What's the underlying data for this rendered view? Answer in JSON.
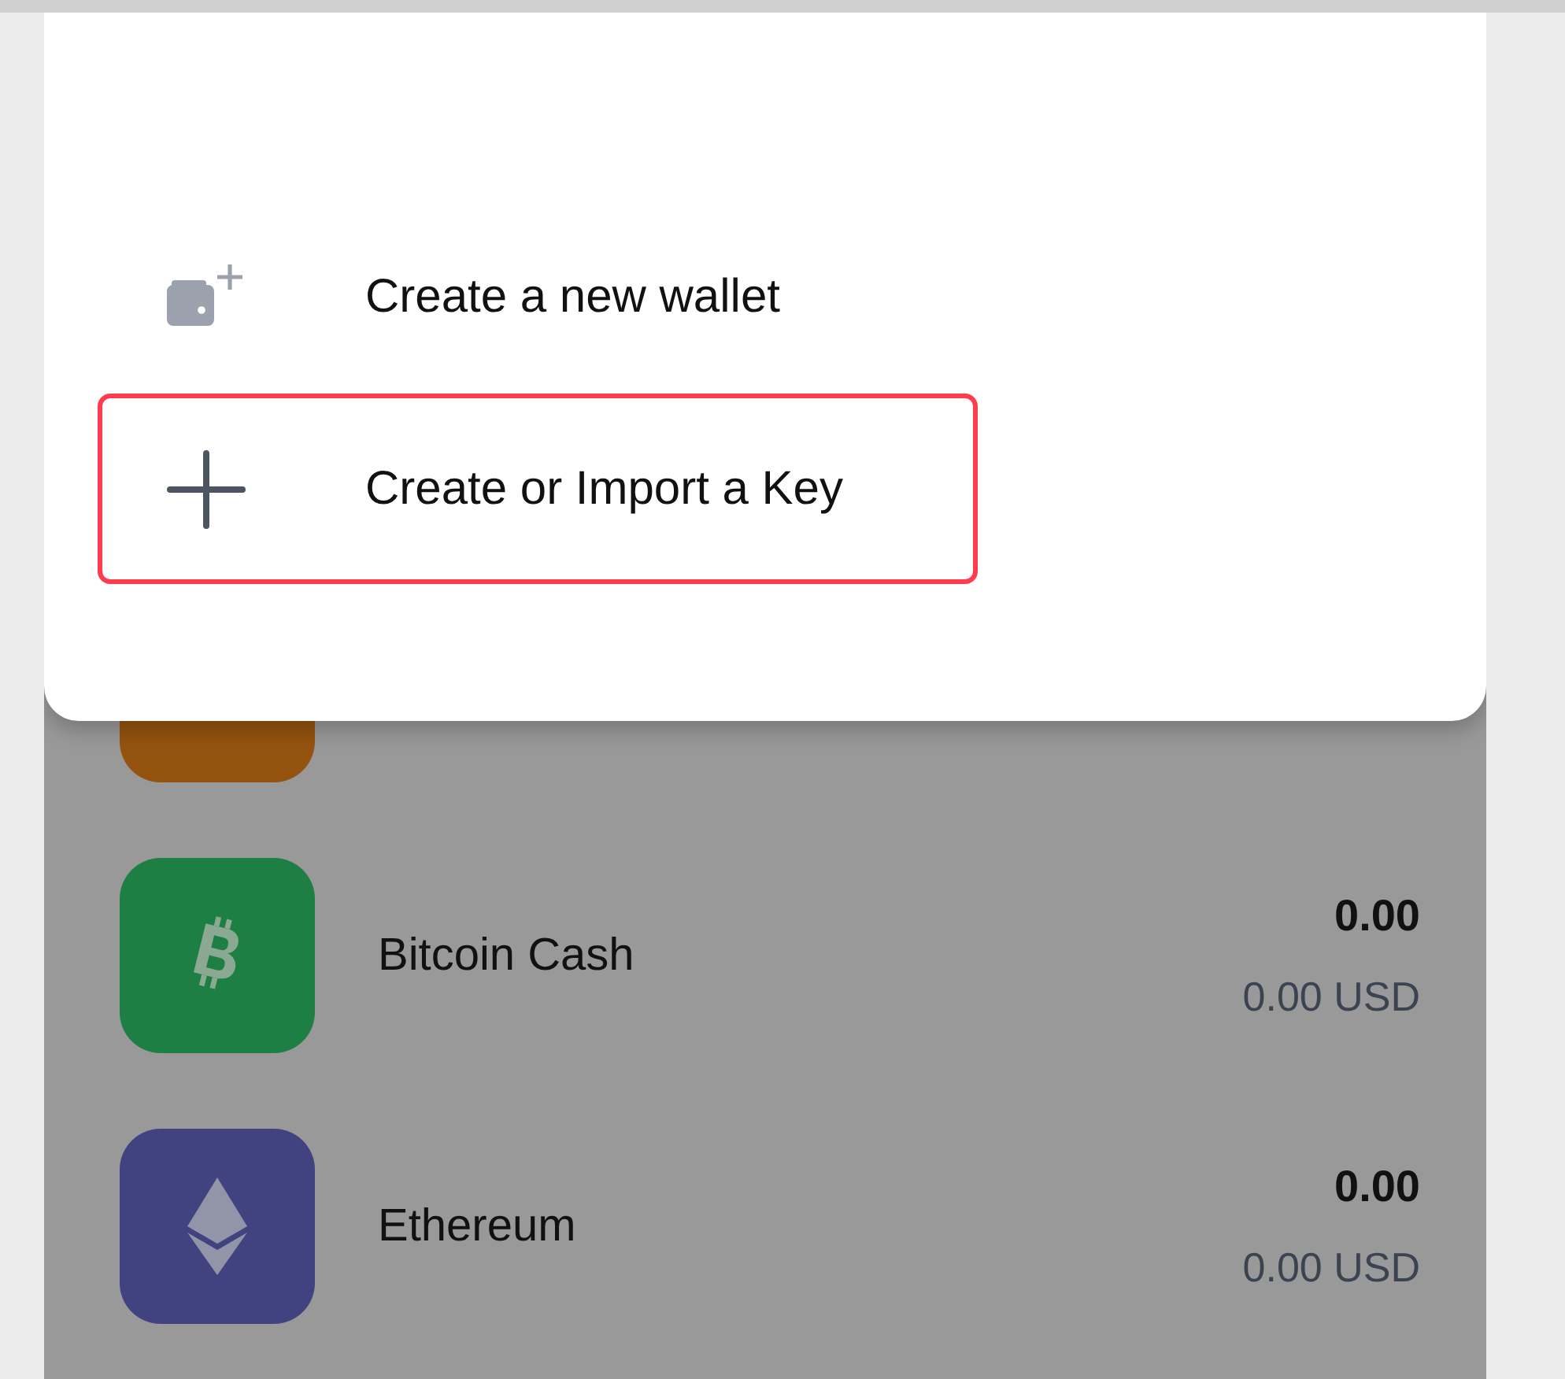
{
  "menu": {
    "items": [
      {
        "kind": "wallet",
        "label": "Create a new wallet",
        "highlighted": false
      },
      {
        "kind": "plus",
        "label": "Create or Import a Key",
        "highlighted": true
      }
    ]
  },
  "assets": [
    {
      "kind": "btc",
      "color": "#955310"
    },
    {
      "kind": "bch",
      "color": "#1e7f44",
      "name": "Bitcoin Cash",
      "amount": "0.00",
      "fiat": "0.00 USD"
    },
    {
      "kind": "eth",
      "color": "#414380",
      "name": "Ethereum",
      "amount": "0.00",
      "fiat": "0.00 USD"
    }
  ]
}
